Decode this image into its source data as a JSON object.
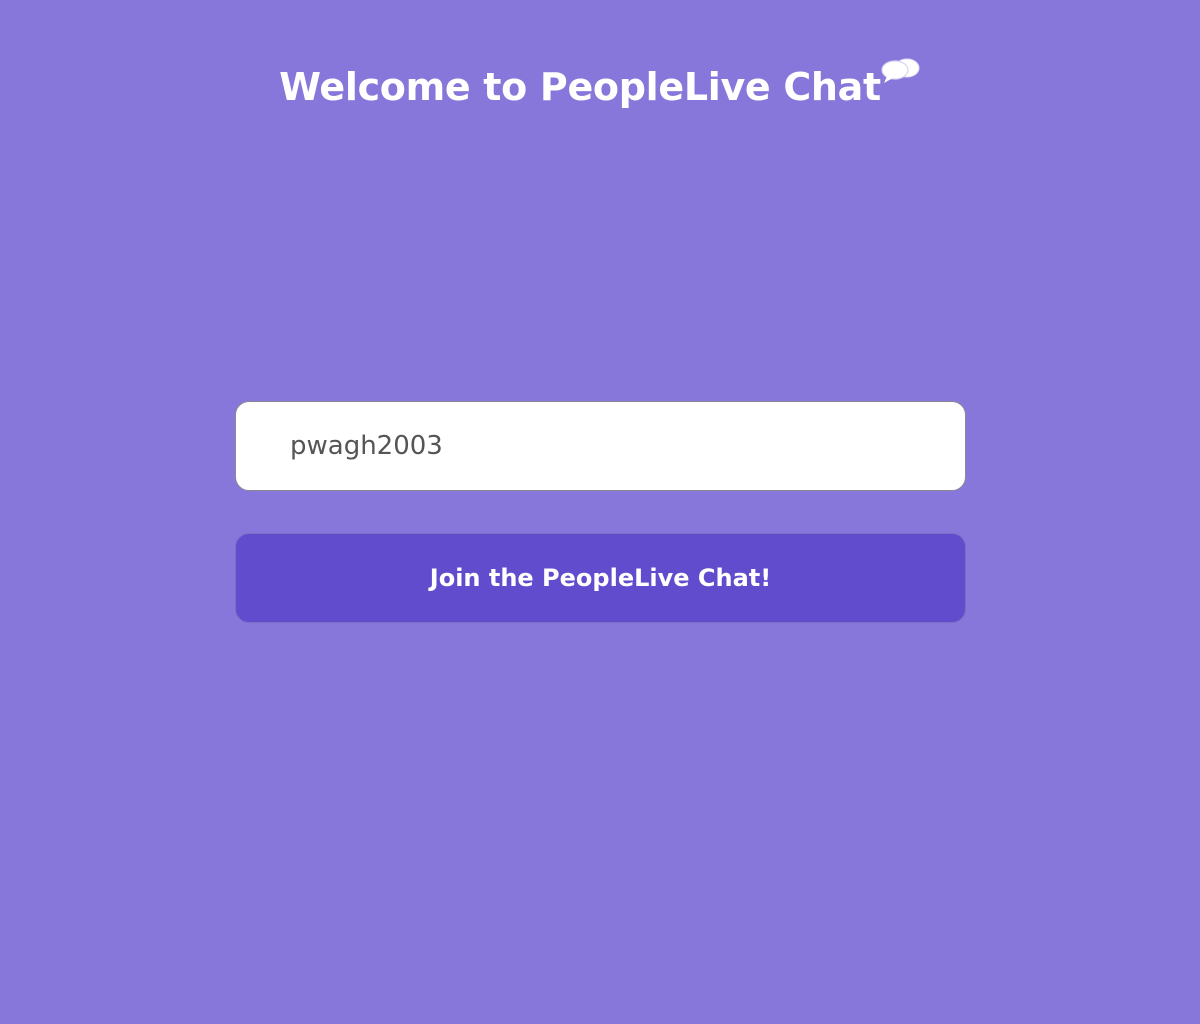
{
  "header": {
    "title": "Welcome to PeopleLive Chat",
    "icon": "chat-bubbles-icon"
  },
  "form": {
    "username_value": "pwagh2003",
    "join_label": "Join the PeopleLive Chat!"
  },
  "colors": {
    "background": "#8777db",
    "button": "#624cce",
    "input_background": "#ffffff",
    "text_light": "#ffffff"
  }
}
